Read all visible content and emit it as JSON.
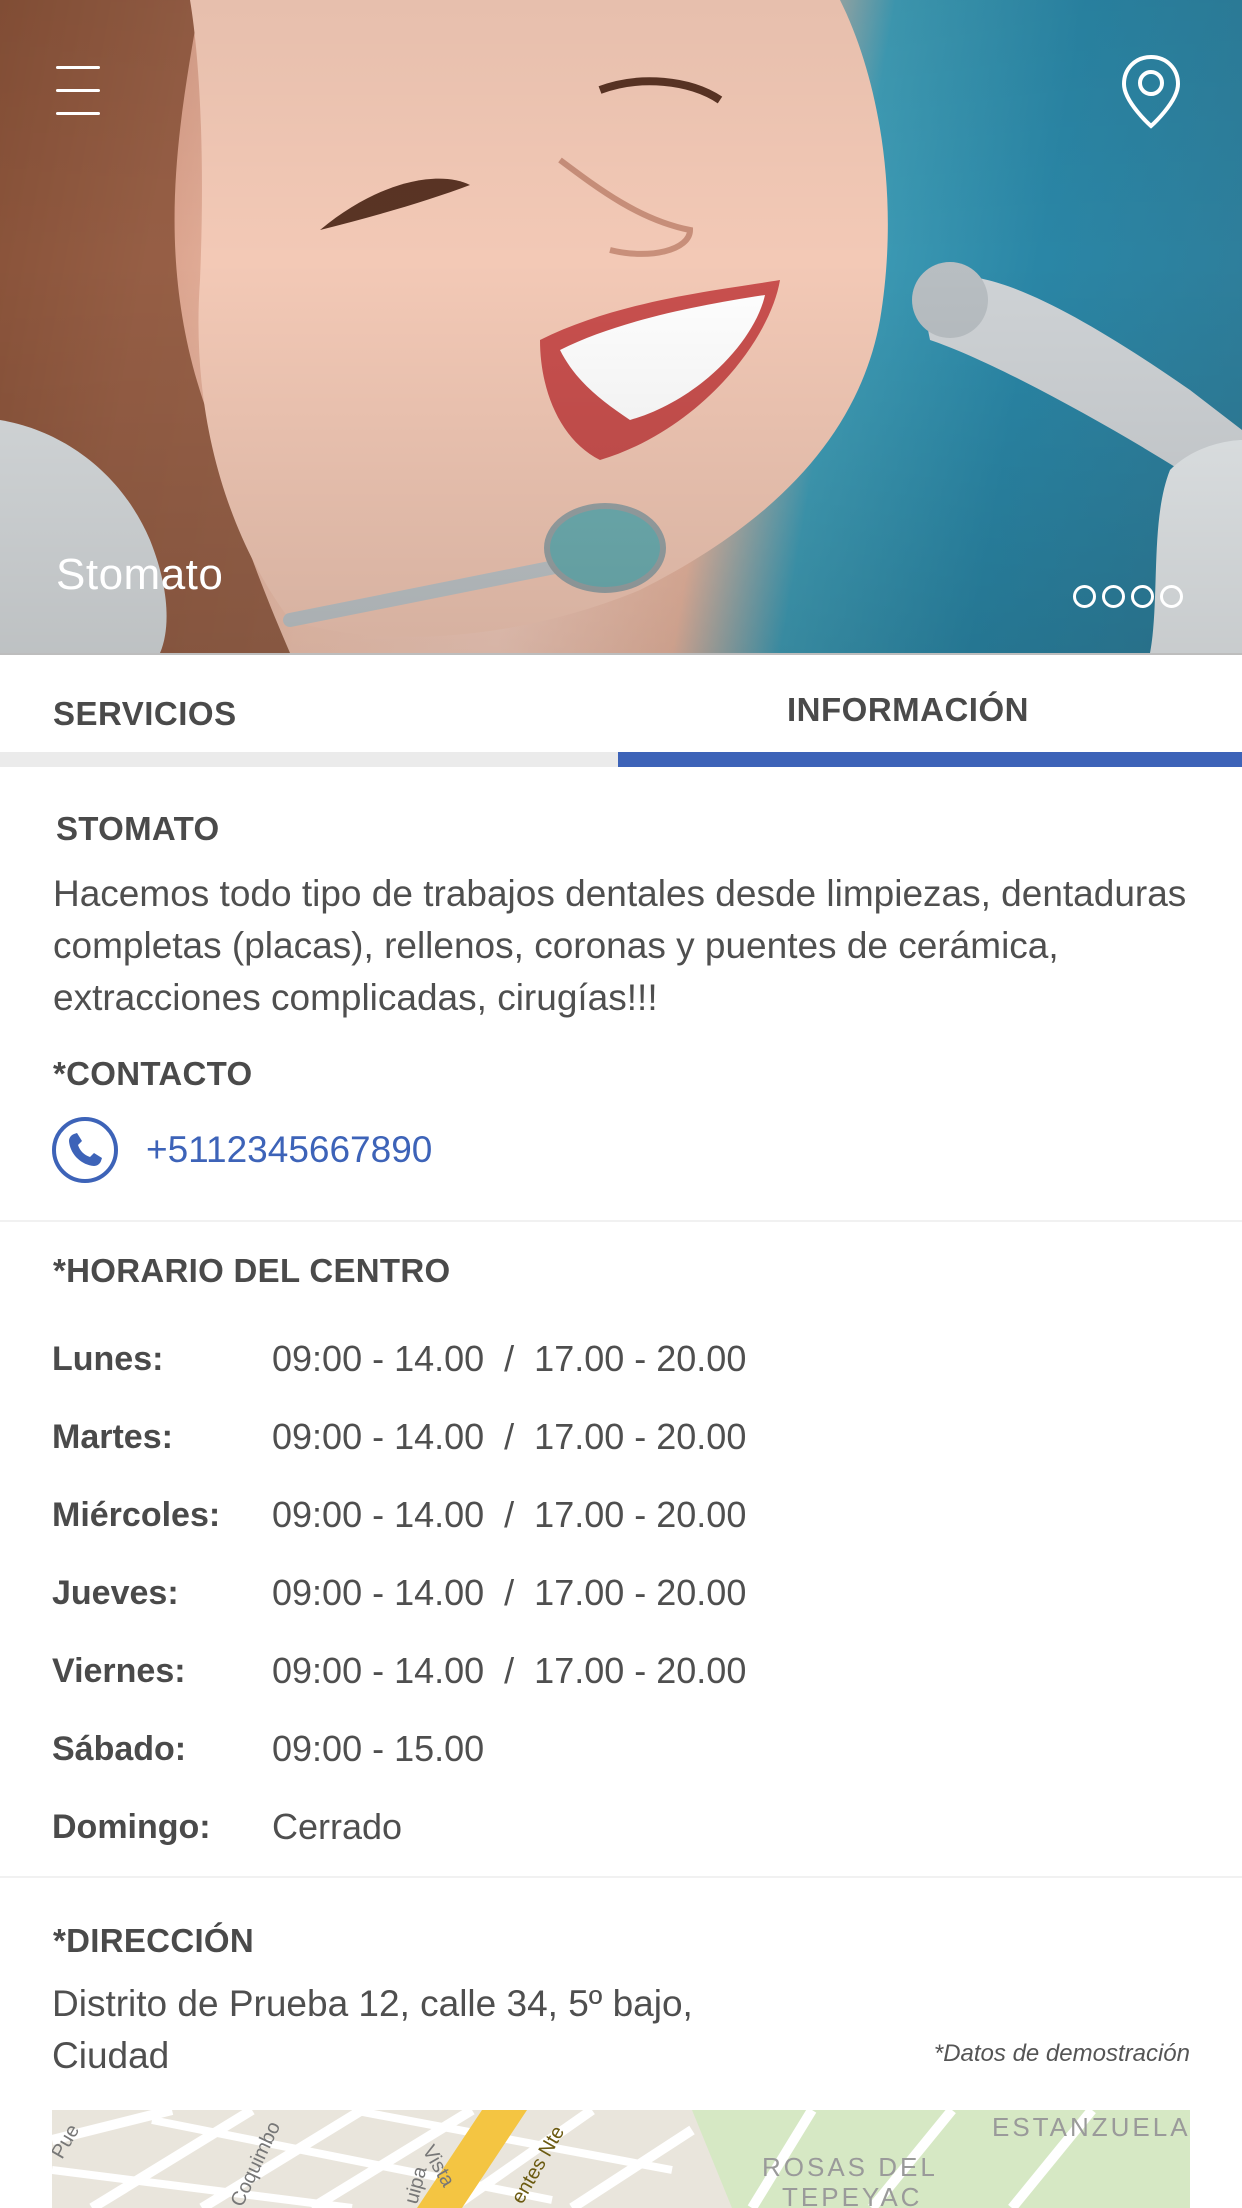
{
  "hero": {
    "title": "Stomato",
    "slide_count": 4
  },
  "tabs": [
    {
      "label": "SERVICIOS",
      "active": false
    },
    {
      "label": "INFORMACIÓN",
      "active": true
    }
  ],
  "info": {
    "name": "STOMATO",
    "description": "Hacemos todo tipo de trabajos dentales desde limpiezas, dentaduras completas (placas), rellenos, coronas y puentes de cerámica, extracciones complicadas, cirugías!!!",
    "contact_title": "*CONTACTO",
    "phone": "+5112345667890",
    "hours_title": "*HORARIO DEL CENTRO",
    "hours": [
      {
        "day": "Lunes:",
        "time": "09:00 - 14.00  /  17.00 - 20.00"
      },
      {
        "day": "Martes:",
        "time": "09:00 - 14.00  /  17.00 - 20.00"
      },
      {
        "day": "Miércoles:",
        "time": "09:00 - 14.00  /  17.00 - 20.00"
      },
      {
        "day": "Jueves:",
        "time": "09:00 - 14.00  /  17.00 - 20.00"
      },
      {
        "day": "Viernes:",
        "time": "09:00 - 14.00  /  17.00 - 20.00"
      },
      {
        "day": "Sábado:",
        "time": "09:00 - 15.00"
      },
      {
        "day": "Domingo:",
        "time": "Cerrado"
      }
    ],
    "address_title": "*DIRECCIÓN",
    "address": "Distrito de Prueba 12, calle 34, 5º bajo, Ciudad",
    "demo_note": "*Datos de demostración"
  },
  "map": {
    "labels": [
      "Pue",
      "Coquimbo",
      "Vista",
      "uipa",
      "entes Nte",
      "ESTANZUELA",
      "ROSAS DEL",
      "TEPEYAC"
    ]
  },
  "colors": {
    "accent": "#3d63b8",
    "text": "#4a4a4a",
    "tab_inactive": "#ebebeb"
  }
}
